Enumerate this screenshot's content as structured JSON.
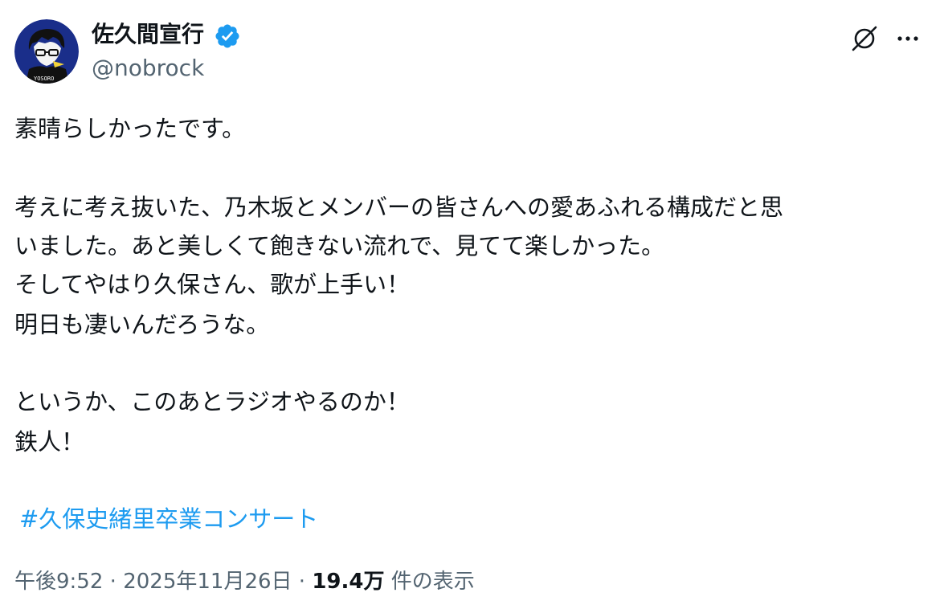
{
  "author": {
    "display_name": "佐久間宣行",
    "handle": "@nobrock",
    "verified": true,
    "avatar_text": "YOSORO"
  },
  "actions": {
    "grok_icon": "grok-icon",
    "more_icon": "more-options-icon"
  },
  "body": {
    "lines": [
      "素晴らしかったです。",
      "考えに考え抜いた、乃木坂とメンバーの皆さんへの愛あふれる構成だと思",
      "いました。あと美しくて飽きない流れで、見てて楽しかった。",
      "そしてやはり久保さん、歌が上手い！",
      "明日も凄いんだろうな。",
      "というか、このあとラジオやるのか！",
      "鉄人！"
    ],
    "hashtag": "#久保史緒里卒業コンサート"
  },
  "meta": {
    "time": "午後9:52",
    "date": "2025年11月26日",
    "separator": "·",
    "views_count": "19.4万",
    "views_label": "件の表示"
  },
  "colors": {
    "text": "#0f1419",
    "secondary": "#536471",
    "link": "#1d9bf0",
    "verified": "#1d9bf0",
    "avatar_bg": "#1a2e8a"
  }
}
